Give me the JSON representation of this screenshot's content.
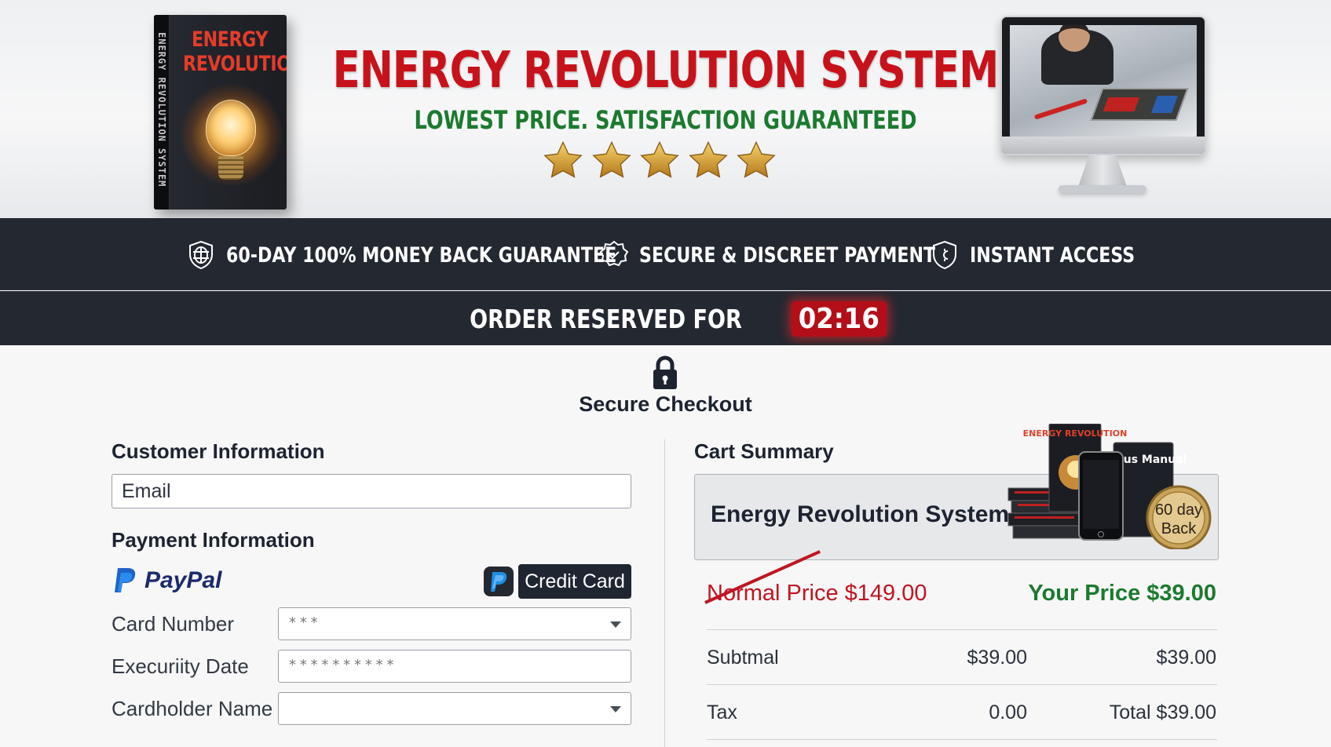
{
  "header": {
    "book_title_line1": "ENERGY",
    "book_title_line2": "REVOLUTION",
    "book_spine": "ENERGY REVOLUTION SYSTEM",
    "title": "ENERGY REVOLUTION SYSTEM",
    "subtitle": "LOWEST PRICE. SATISFACTION GUARANTEED",
    "rating_stars": 5
  },
  "guarantees": [
    {
      "label": "60-DAY 100% MONEY BACK GUARANTEE",
      "icon": "globe-shield-icon"
    },
    {
      "label": "SECURE & DISCREET PAYMENT",
      "icon": "secure-badge-icon"
    },
    {
      "label": "INSTANT ACCESS",
      "icon": "shield-icon"
    }
  ],
  "reservation": {
    "label": "ORDER RESERVED FOR",
    "timer": "02:16"
  },
  "checkout": {
    "title": "Secure Checkout",
    "customer": {
      "heading": "Customer Information",
      "email_placeholder": "Email"
    },
    "payment": {
      "heading": "Payment Information",
      "paypal_label": "PayPal",
      "credit_card_label": "Credit Card",
      "fields": [
        {
          "label": "Card Number",
          "value": "***",
          "type": "dropdown"
        },
        {
          "label": "Execuriity Date",
          "value": "**********",
          "type": "text"
        },
        {
          "label": "Cardholder Name",
          "value": "",
          "type": "dropdown"
        }
      ]
    }
  },
  "cart": {
    "heading": "Cart Summary",
    "product": "Energy Revolution System",
    "bundle": {
      "book_label": "ENERGY REVOLUTION",
      "manual_label": "Bonus Manual",
      "seal_line1": "60 day",
      "seal_line2": "Back"
    },
    "normal_price": "Normal Price $149.00",
    "your_price": "Your Price $39.00",
    "rows": [
      {
        "label": "Subtmal",
        "amount": "$39.00",
        "total": "$39.00"
      },
      {
        "label": "Tax",
        "amount": "0.00",
        "total": "Total $39.00"
      }
    ]
  },
  "colors": {
    "brand_red": "#c8121b",
    "accent_green": "#1c7a2f",
    "dark_band": "#232831",
    "timer_red": "#b40e18"
  }
}
